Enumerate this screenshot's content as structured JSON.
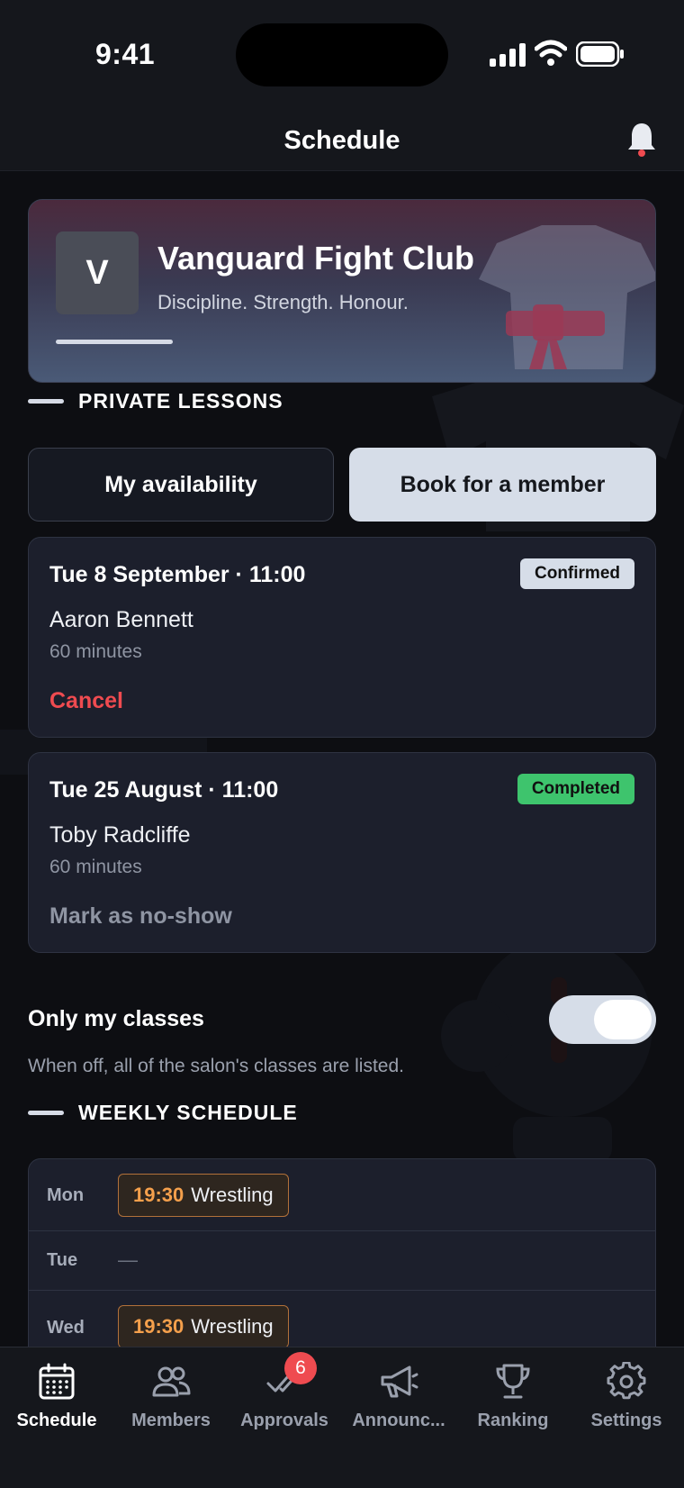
{
  "status": {
    "time": "9:41"
  },
  "header": {
    "title": "Schedule",
    "bell_icon": "bell-icon"
  },
  "club": {
    "logo_letter": "V",
    "name": "Vanguard Fight Club",
    "motto": "Discipline. Strength. Honour."
  },
  "private_lessons": {
    "section_title": "PRIVATE LESSONS",
    "my_availability_label": "My availability",
    "book_label": "Book for a member",
    "lessons": [
      {
        "date": "Tue 8 September · 11:00",
        "status": "Confirmed",
        "member": "Aaron Bennett",
        "duration": "60 minutes",
        "action": "Cancel"
      },
      {
        "date": "Tue 25 August · 11:00",
        "status": "Completed",
        "member": "Toby Radcliffe",
        "duration": "60 minutes",
        "action": "Mark as no-show"
      }
    ]
  },
  "filter": {
    "label": "Only my classes",
    "hint": "When off, all of the salon's classes are listed.",
    "enabled": true
  },
  "weekly": {
    "section_title": "WEEKLY SCHEDULE",
    "days": [
      {
        "day": "Mon",
        "time": "19:30",
        "class": "Wrestling"
      },
      {
        "day": "Tue",
        "empty": "—"
      },
      {
        "day": "Wed",
        "time": "19:30",
        "class": "Wrestling"
      }
    ]
  },
  "tabs": [
    {
      "label": "Schedule",
      "icon": "calendar-icon",
      "active": true
    },
    {
      "label": "Members",
      "icon": "members-icon"
    },
    {
      "label": "Approvals",
      "icon": "approvals-icon",
      "badge": "6"
    },
    {
      "label": "Announc...",
      "icon": "megaphone-icon"
    },
    {
      "label": "Ranking",
      "icon": "trophy-icon"
    },
    {
      "label": "Settings",
      "icon": "gear-icon"
    }
  ],
  "colors": {
    "accent": "#d6dde8",
    "danger": "#ef4b50",
    "success": "#3ec46d",
    "class_time": "#f5a04c"
  }
}
